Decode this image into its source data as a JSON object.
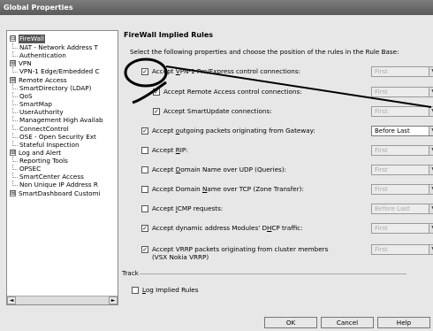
{
  "window": {
    "title": "Global Properties"
  },
  "tree": {
    "items": [
      {
        "label": "FireWall",
        "selected": true,
        "expander": "⊟"
      },
      {
        "label": "NAT - Network Address T"
      },
      {
        "label": "Authentication"
      },
      {
        "label": "VPN",
        "expander": "⊞"
      },
      {
        "label": "VPN-1 Edge/Embedded C"
      },
      {
        "label": "Remote Access",
        "expander": "⊞"
      },
      {
        "label": "SmartDirectory (LDAP)"
      },
      {
        "label": "QoS"
      },
      {
        "label": "SmartMap"
      },
      {
        "label": "UserAuthority"
      },
      {
        "label": "Management High Availab"
      },
      {
        "label": "ConnectControl"
      },
      {
        "label": "OSE - Open Security Ext"
      },
      {
        "label": "Stateful Inspection"
      },
      {
        "label": "Log and Alert",
        "expander": "⊞"
      },
      {
        "label": "Reporting Tools"
      },
      {
        "label": "OPSEC"
      },
      {
        "label": "SmartCenter Access"
      },
      {
        "label": "Non Unique IP Address R"
      },
      {
        "label": "SmartDashboard Customi",
        "expander": "⊞"
      }
    ],
    "scroll_left": "◄",
    "scroll_right": "►"
  },
  "panel": {
    "title": "FireWall Implied Rules",
    "description": "Select the following properties and choose the position of the rules in the Rule Base:",
    "rules": [
      {
        "pre": "Accept ",
        "acc": "V",
        "post": "PN-1 Pro/Express control connections:",
        "checked": true,
        "position": "First",
        "enabled": false
      },
      {
        "pre": "Accept Remote Access control connections:",
        "acc": "",
        "post": "",
        "checked": true,
        "position": "First",
        "enabled": false
      },
      {
        "pre": "Accept SmartUpdate connections:",
        "acc": "",
        "post": "",
        "checked": true,
        "position": "First",
        "enabled": false
      },
      {
        "pre": "Accept ",
        "acc": "o",
        "post": "utgoing packets originating from Gateway:",
        "checked": true,
        "position": "Before Last",
        "enabled": true
      },
      {
        "pre": "Accept ",
        "acc": "R",
        "post": "IP:",
        "checked": false,
        "position": "First",
        "enabled": false
      },
      {
        "pre": "Accept ",
        "acc": "D",
        "post": "omain Name over UDP (Queries):",
        "checked": false,
        "position": "First",
        "enabled": false
      },
      {
        "pre": "Accept Domain ",
        "acc": "N",
        "post": "ame over TCP (Zone Transfer):",
        "checked": false,
        "position": "First",
        "enabled": false
      },
      {
        "pre": "Accept ",
        "acc": "I",
        "post": "CMP requests:",
        "checked": false,
        "position": "Before Last",
        "enabled": false
      },
      {
        "pre": "Accept dynamic address Modules' D",
        "acc": "H",
        "post": "CP traffic:",
        "checked": true,
        "position": "First",
        "enabled": false
      },
      {
        "pre": "Accept VRRP packets originating from cluster members",
        "acc": "",
        "post": "",
        "checked": true,
        "position": "First",
        "enabled": false,
        "line2": "(VSX Nokia VRRP)"
      }
    ],
    "track_label": "Track",
    "log_rule": {
      "acc": "L",
      "post": "og Implied Rules",
      "checked": false
    }
  },
  "buttons": {
    "ok": "OK",
    "cancel": "Cancel",
    "help": "Help"
  },
  "icons": {
    "checkmark": "✓",
    "dropdown_arrow": "▼"
  }
}
